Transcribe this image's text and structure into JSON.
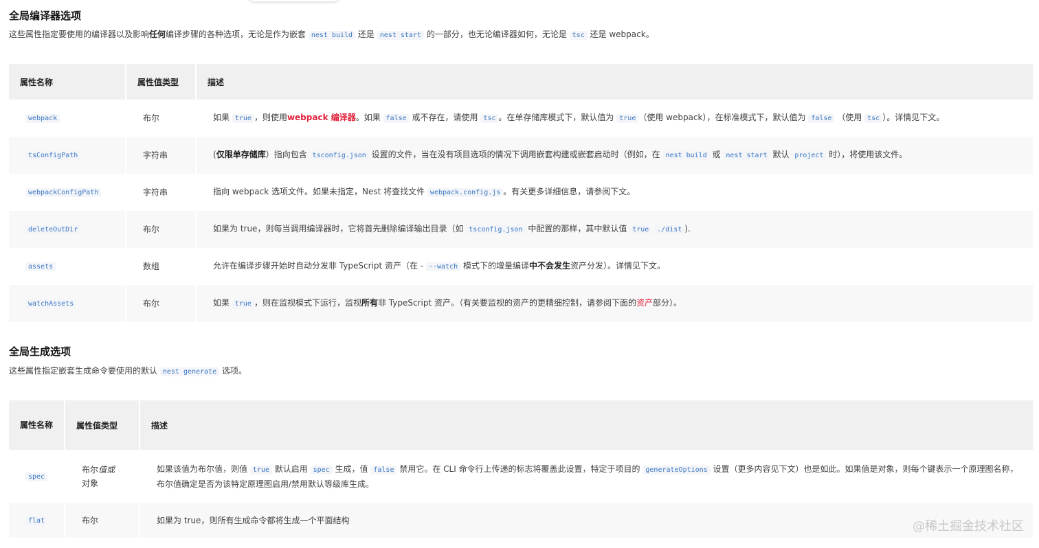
{
  "section1": {
    "title": "全局编译器选项",
    "intro": {
      "p1": "这些属性指定要使用的编译器以及影响",
      "bold": "任何",
      "p2": "编译步骤的各种选项，无论是作为嵌套",
      "code1": "nest build",
      "p3": "还是",
      "code2": "nest start",
      "p4": "的一部分，也无论编译器如何，无论是",
      "code3": "tsc",
      "p5": "还是 webpack。"
    },
    "headers": [
      "属性名称",
      "属性值类型",
      "描述"
    ],
    "rows": [
      {
        "name": "webpack",
        "type": "布尔",
        "d": {
          "t1": "如果",
          "c1": "true",
          "t2": "，则使用",
          "red": "webpack 编译器",
          "t3": "。如果",
          "c2": "false",
          "t4": "或不存在，请使用",
          "c3": "tsc",
          "t5": "。在单存储库模式下，默认值为",
          "c4": "true",
          "t6": "（使用 webpack），在标准模式下，默认值为",
          "c5": "false",
          "t7": "（使用",
          "c6": "tsc",
          "t8": "）。详情见下文。"
        }
      },
      {
        "name": "tsConfigPath",
        "type": "字符串",
        "d": {
          "t1": "(",
          "bold": "仅限单存储库",
          "t2": "）指向包含",
          "c1": "tsconfig.json",
          "t3": "设置的文件，当在没有项目选项的情况下调用嵌套构建或嵌套启动时（例如，在",
          "c2": "nest build",
          "t4": "或",
          "c3": "nest start",
          "t5": "默认",
          "c4": "project",
          "t6": "时），将使用该文件。"
        }
      },
      {
        "name": "webpackConfigPath",
        "type": "字符串",
        "d": {
          "t1": "指向 webpack 选项文件。如果未指定，Nest 将查找文件",
          "c1": "webpack.config.js",
          "t2": "。有关更多详细信息，请参阅下文。"
        }
      },
      {
        "name": "deleteOutDir",
        "type": "布尔",
        "d": {
          "t1": "如果为 true，则每当调用编译器时，它将首先删除编译输出目录（如",
          "c1": "tsconfig.json",
          "t2": "中配置的那样，其中默认值",
          "c2": "true",
          "c3": "./dist",
          "t3": ")."
        }
      },
      {
        "name": "assets",
        "type": "数组",
        "d": {
          "t1": "允许在编译步骤开始时自动分发非 TypeScript 资产（在 -",
          "c1": "--watch",
          "t2": "模式下的增量编译",
          "bold": "中不会发生",
          "t3": "资产分发）。详情见下文。"
        }
      },
      {
        "name": "watchAssets",
        "type": "布尔",
        "d": {
          "t1": "如果",
          "c1": "true",
          "t2": "，则在监视模式下运行，监视",
          "bold": "所有",
          "t3": "非 TypeScript 资产。（有关要监视的资产的更精细控制，请参阅下面的",
          "red": "资产",
          "t4": "部分）。"
        }
      }
    ]
  },
  "section2": {
    "title": "全局生成选项",
    "intro": {
      "p1": "这些属性指定嵌套生成命令要使用的默认",
      "code1": "nest generate",
      "p2": "选项。"
    },
    "headers": [
      "属性名称",
      "属性值类型",
      "描述"
    ],
    "rows": [
      {
        "name": "spec",
        "type_a": "布尔",
        "type_i": "值或",
        "type_b": "对象",
        "d": {
          "t1": "如果该值为布尔值，则值",
          "c1": "true",
          "t2": "默认启用",
          "c2": "spec",
          "t3": "生成，值",
          "c3": "false",
          "t4": "禁用它。在 CLI 命令行上传递的标志将覆盖此设置，特定于项目的",
          "c4": "generateOptions",
          "t5": "设置（更多内容见下文）也是如此。如果值是对象，则每个键表示一个原理图名称，布尔值确定是否为该特定原理图启用/禁用默认等级库生成。"
        }
      },
      {
        "name": "flat",
        "type": "布尔",
        "d": {
          "t1": "如果为 true，则所有生成命令都将生成一个平面结构"
        }
      }
    ]
  },
  "watermark": "@稀土掘金技术社区"
}
